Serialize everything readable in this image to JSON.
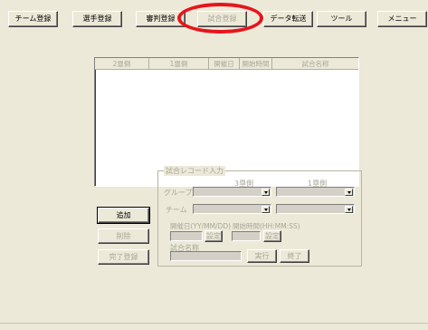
{
  "toolbar": {
    "items": [
      {
        "label": "チーム登録",
        "state": "normal"
      },
      {
        "label": "選手登録",
        "state": "normal"
      },
      {
        "label": "審判登録",
        "state": "normal"
      },
      {
        "label": "試合登録",
        "state": "disabled"
      },
      {
        "label": "データ転送",
        "state": "normal"
      },
      {
        "label": "ツール",
        "state": "normal"
      },
      {
        "label": "メニュー",
        "state": "normal"
      }
    ]
  },
  "list": {
    "columns": [
      "2塁側",
      "1塁側",
      "開催日",
      "開始時間",
      "試合名称"
    ],
    "rows": []
  },
  "actions": {
    "add_label": "追加",
    "delete_label": "削除",
    "full_register_label": "完了登録"
  },
  "form": {
    "title": "試合レコード入力",
    "side3_label": "3塁側",
    "side1_label": "1塁側",
    "group_label": "グループ",
    "team_label": "チーム",
    "date_label": "開催日(YY/MM/DD)",
    "time_label": "開始時間(HH:MM:SS)",
    "set_label": "設定",
    "match_name_label": "試合名称",
    "execute_label": "実行",
    "end_label": "終了"
  },
  "annotation": {
    "color": "#e8141c"
  }
}
